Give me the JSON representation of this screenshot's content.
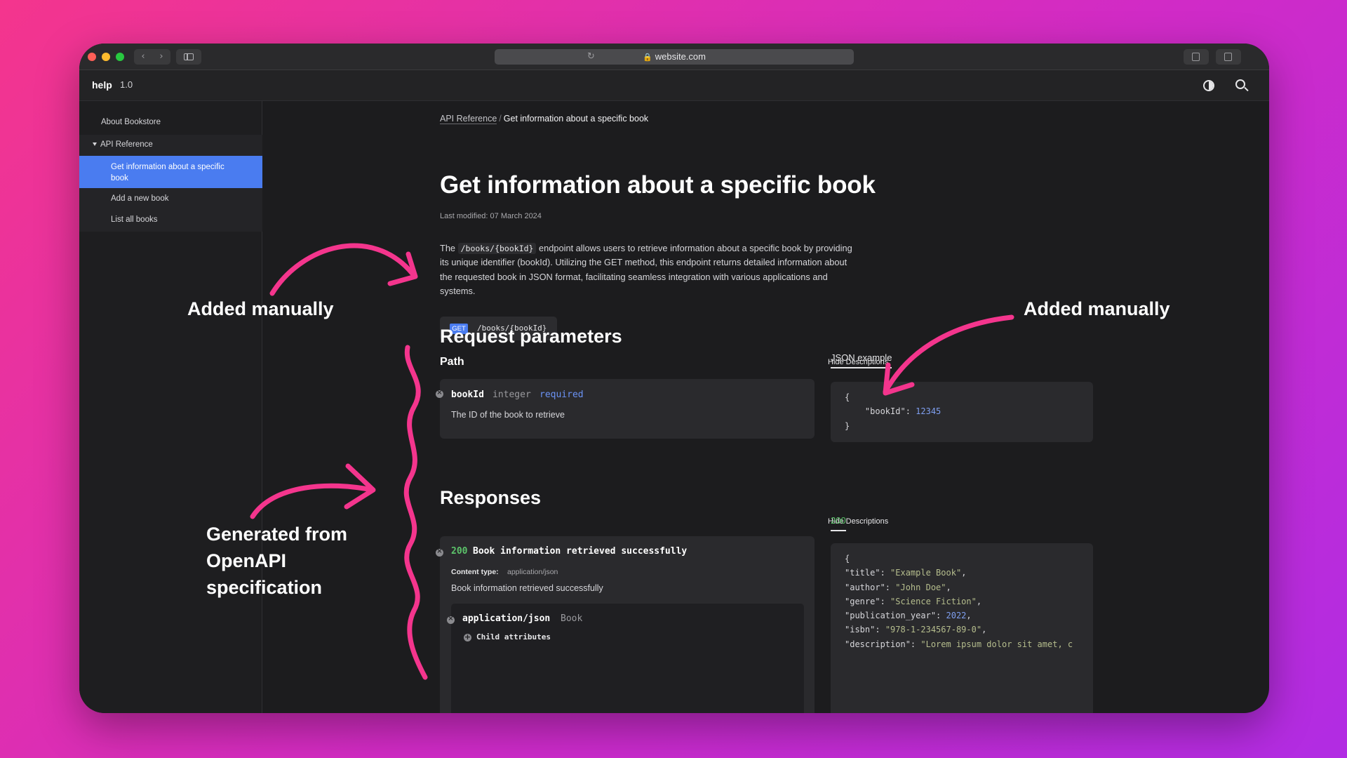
{
  "browser": {
    "url": "website.com",
    "colors": {
      "close": "#ff5f57",
      "minimize": "#febc2e",
      "maximize": "#28c840"
    },
    "nav_back_icon": "chevron-left-icon",
    "nav_forward_icon": "chevron-right-icon"
  },
  "app": {
    "brand": "help",
    "version": "1.0"
  },
  "sidebar": {
    "items": [
      {
        "label": "About Bookstore"
      },
      {
        "label": "API Reference"
      },
      {
        "label": "Get information about a specific book"
      },
      {
        "label": "Add a new book"
      },
      {
        "label": "List all books"
      }
    ]
  },
  "breadcrumb": {
    "parent": "API Reference",
    "separator": "/",
    "current": "Get information about a specific book"
  },
  "page": {
    "title": "Get information about a specific book",
    "last_modified": "Last modified: 07 March 2024",
    "description": {
      "before": "The ",
      "code": "/books/{bookId}",
      "after": " endpoint allows users to retrieve information about a specific book by providing its unique identifier (bookId). Utilizing the GET method, this endpoint returns detailed information about the requested book in JSON format, facilitating seamless integration with various applications and systems."
    },
    "endpoint": {
      "method": "GET",
      "path": "/books/{bookId}"
    }
  },
  "request": {
    "heading": "Request parameters",
    "subheading": "Path",
    "hide_label": "Hide Descriptions",
    "param": {
      "name": "bookId",
      "type": "integer",
      "required": "required",
      "description": "The ID of the book to retrieve"
    },
    "example_tab": "JSON example",
    "example": {
      "open": "{",
      "key": "\"bookId\"",
      "colon": ": ",
      "value": "12345",
      "close": "}"
    }
  },
  "responses": {
    "heading": "Responses",
    "hide_label": "Hide Descriptions",
    "tab": "200",
    "item": {
      "code": "200",
      "title": "Book information retrieved successfully",
      "content_type_label": "Content type:",
      "content_type": "application/json",
      "description": "Book information retrieved successfully",
      "media_type": "application/json",
      "schema": "Book",
      "child_label": "Child attributes"
    },
    "example": {
      "open": "{",
      "lines": [
        {
          "key": "\"title\"",
          "value": "\"Example Book\"",
          "kind": "str",
          "comma": ","
        },
        {
          "key": "\"author\"",
          "value": "\"John Doe\"",
          "kind": "str",
          "comma": ","
        },
        {
          "key": "\"genre\"",
          "value": "\"Science Fiction\"",
          "kind": "str",
          "comma": ","
        },
        {
          "key": "\"publication_year\"",
          "value": "2022",
          "kind": "num",
          "comma": ","
        },
        {
          "key": "\"isbn\"",
          "value": "\"978-1-234567-89-0\"",
          "kind": "str",
          "comma": ","
        },
        {
          "key": "\"description\"",
          "value": "\"Lorem ipsum dolor sit amet, c",
          "kind": "str",
          "comma": ""
        }
      ]
    }
  },
  "annotations": {
    "left_top": "Added manually",
    "right_top": "Added manually",
    "left_bottom": [
      "Generated from",
      "OpenAPI",
      "specification"
    ],
    "color": "#f4358d"
  }
}
